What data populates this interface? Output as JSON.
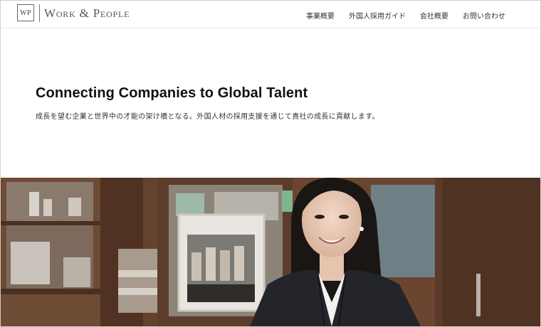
{
  "brand": {
    "mark": "WP",
    "name": "Work & People"
  },
  "nav": {
    "items": [
      {
        "label": "事業概要"
      },
      {
        "label": "外国人採用ガイド"
      },
      {
        "label": "会社概要"
      },
      {
        "label": "お問い合わせ"
      }
    ]
  },
  "hero": {
    "title": "Connecting Companies to Global Talent",
    "subtitle": "成長を望む企業と世界中の才能の架け橋となる。外国人材の採用支援を通じて貴社の成長に貢献します。"
  },
  "photo": {
    "subject": "smiling woman in dark blazer standing in front of wooden shelves"
  }
}
